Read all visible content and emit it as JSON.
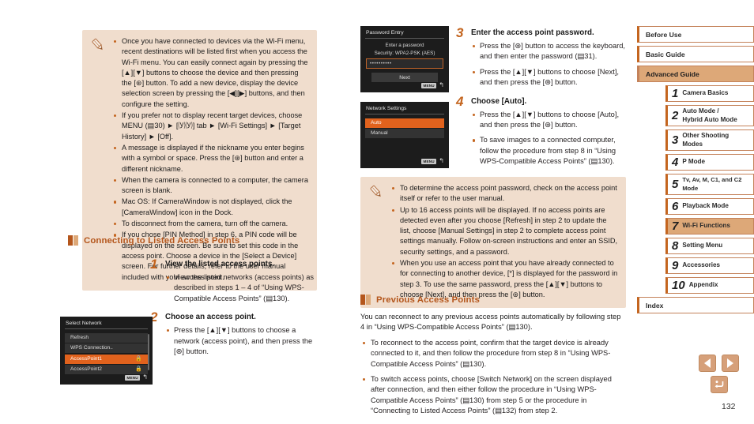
{
  "page_number": "132",
  "colors": {
    "accent": "#c4651f",
    "heading": "#b4561c",
    "note_bg": "#f0ddcd",
    "nav_active_bg": "#dda878",
    "nav_border": "#c4825a",
    "lcd_bg": "#1c1c1c",
    "lcd_selected": "#e1621d"
  },
  "note_top": {
    "icon": "pencil-note-icon",
    "items": [
      "Once you have connected to devices via the Wi-Fi menu, recent destinations will be listed first when you access the Wi-Fi menu. You can easily connect again by pressing the [▲][▼] buttons to choose the device and then pressing the [⊛] button. To add a new device, display the device selection screen by pressing the [◀][▶] buttons, and then configure the setting.",
      "If you prefer not to display recent target devices, choose MENU (▤30) ► [⒴⒴] tab ► [Wi-Fi Settings] ► [Target History] ► [Off].",
      "A message is displayed if the nickname you enter begins with a symbol or space. Press the [⊛] button and enter a different nickname.",
      "When the camera is connected to a computer, the camera screen is blank.",
      "Mac OS: If CameraWindow is not displayed, click the [CameraWindow] icon in the Dock.",
      "To disconnect from the camera, turn off the camera.",
      "If you chose [PIN Method] in step 6, a PIN code will be displayed on the screen. Be sure to set this code in the access point. Choose a device in the [Select a Device] screen. For further details, refer to the user manual included with your access point."
    ]
  },
  "section_listed": {
    "heading": "Connecting to Listed Access Points",
    "steps": [
      {
        "num": "1",
        "title": "View the listed access points.",
        "bullets": [
          "View the listed networks (access points) as described in steps 1 – 4 of “Using WPS-Compatible Access Points” (▤130)."
        ]
      },
      {
        "num": "2",
        "title": "Choose an access point.",
        "bullets": [
          "Press the [▲][▼] buttons to choose a network (access point), and then press the [⊛] button."
        ]
      }
    ]
  },
  "screens": {
    "select_network": {
      "title": "Select Network",
      "rows": [
        {
          "label": "Refresh",
          "selected": false,
          "locked": false
        },
        {
          "label": "WPS Connection..",
          "selected": false,
          "locked": false
        },
        {
          "label": "AccessPoint1",
          "selected": true,
          "locked": true
        },
        {
          "label": "AccessPoint2",
          "selected": false,
          "locked": true
        }
      ],
      "menu_chip": "MENU",
      "return_glyph": "↰"
    },
    "password_entry": {
      "title": "Password Entry",
      "prompt": "Enter a password",
      "security_label": "Security:",
      "security_value": "WPA2-PSK (AES)",
      "password_masked": "••••••••••",
      "next_label": "Next",
      "menu_chip": "MENU",
      "return_glyph": "↰"
    },
    "network_settings": {
      "title": "Network Settings",
      "rows": [
        {
          "label": "Auto",
          "selected": true
        },
        {
          "label": "Manual",
          "selected": false
        }
      ],
      "menu_chip": "MENU",
      "return_glyph": "↰"
    }
  },
  "steps_right": [
    {
      "num": "3",
      "title": "Enter the access point password.",
      "bullets": [
        "Press the [⊛] button to access the keyboard, and then enter the password (▤31).",
        "Press the [▲][▼] buttons to choose [Next], and then press the [⊛] button."
      ]
    },
    {
      "num": "4",
      "title": "Choose [Auto].",
      "bullets": [
        "Press the [▲][▼] buttons to choose [Auto], and then press the [⊛] button.",
        "To save images to a connected computer, follow the procedure from step 8 in “Using WPS-Compatible Access Points” (▤130)."
      ]
    }
  ],
  "note_bottom": {
    "icon": "pencil-note-icon",
    "items": [
      "To determine the access point password, check on the access point itself or refer to the user manual.",
      "Up to 16 access points will be displayed. If no access points are detected even after you choose [Refresh] in step 2 to update the list, choose [Manual Settings] in step 2 to complete access point settings manually. Follow on-screen instructions and enter an SSID, security settings, and a password.",
      "When you use an access point that you have already connected to for connecting to another device, [*] is displayed for the password in step 3. To use the same password, press the [▲][▼] buttons to choose [Next], and then press the [⊛] button."
    ]
  },
  "section_previous": {
    "heading": "Previous Access Points",
    "intro": "You can reconnect to any previous access points automatically by following step 4 in “Using WPS-Compatible Access Points” (▤130).",
    "bullets": [
      "To reconnect to the access point, confirm that the target device is already connected to it, and then follow the procedure from step 8 in “Using WPS-Compatible Access Points” (▤130).",
      "To switch access points, choose [Switch Network] on the screen displayed after connection, and then either follow the procedure in “Using WPS-Compatible Access Points” (▤130) from step 5 or the procedure in “Connecting to Listed Access Points” (▤132) from step 2."
    ]
  },
  "sidebar": {
    "top_items": [
      {
        "label": "Before Use",
        "active": false
      },
      {
        "label": "Basic Guide",
        "active": false
      },
      {
        "label": "Advanced Guide",
        "active": true
      }
    ],
    "chapters": [
      {
        "num": "1",
        "label": "Camera Basics",
        "active": false
      },
      {
        "num": "2",
        "label": "Auto Mode /\nHybrid Auto Mode",
        "active": false
      },
      {
        "num": "3",
        "label": "Other Shooting Modes",
        "active": false
      },
      {
        "num": "4",
        "label": "P Mode",
        "active": false
      },
      {
        "num": "5",
        "label": "Tv, Av, M, C1, and C2 Mode",
        "active": false
      },
      {
        "num": "6",
        "label": "Playback Mode",
        "active": false
      },
      {
        "num": "7",
        "label": "Wi-Fi Functions",
        "active": true
      },
      {
        "num": "8",
        "label": "Setting Menu",
        "active": false
      },
      {
        "num": "9",
        "label": "Accessories",
        "active": false
      },
      {
        "num": "10",
        "label": "Appendix",
        "active": false
      }
    ],
    "index_label": "Index"
  },
  "footer_nav": {
    "prev": "previous-page",
    "next": "next-page",
    "home": "return-home"
  }
}
